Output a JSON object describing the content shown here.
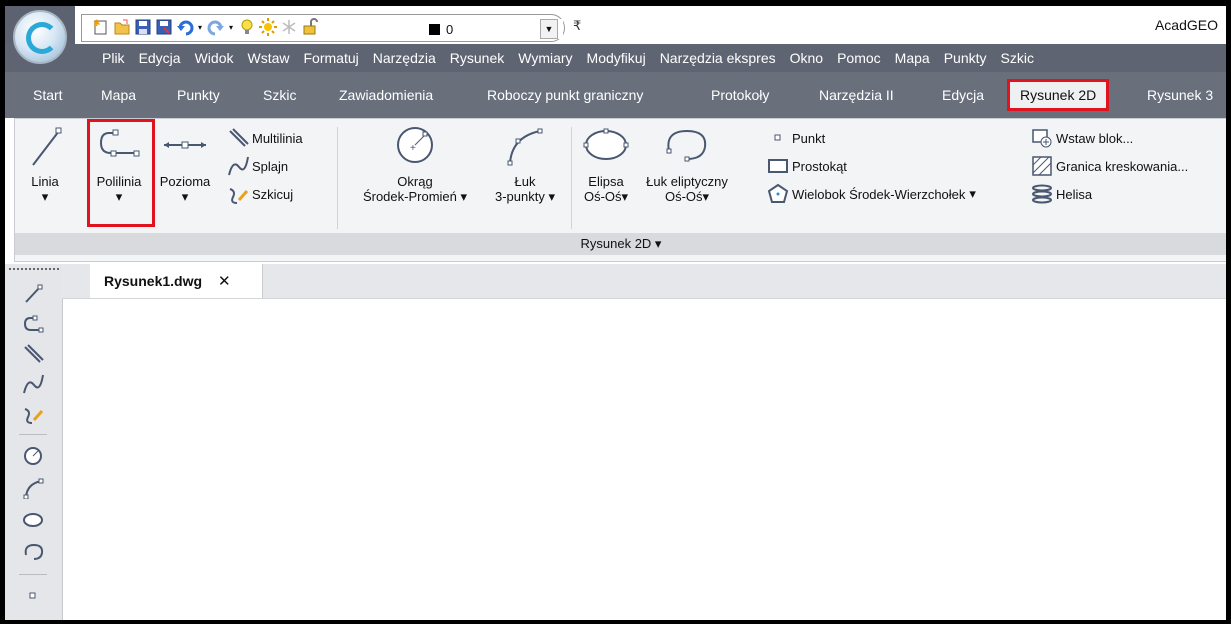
{
  "app": {
    "title": "AcadGEO"
  },
  "quick_access": {
    "layer_value": "0",
    "icons": [
      "new-file-icon",
      "open-folder-icon",
      "save-icon",
      "save-as-icon",
      "undo-icon",
      "redo-icon",
      "lightbulb-icon",
      "sun-icon",
      "layer-freeze-icon",
      "lock-icon",
      "color-swatch-icon"
    ]
  },
  "menu": [
    "Plik",
    "Edycja",
    "Widok",
    "Wstaw",
    "Formatuj",
    "Narzędzia",
    "Rysunek",
    "Wymiary",
    "Modyfikuj",
    "Narzędzia ekspres",
    "Okno",
    "Pomoc",
    "Mapa",
    "Punkty",
    "Szkic"
  ],
  "tabs": [
    "Start",
    "Mapa",
    "Punkty",
    "Szkic",
    "Zawiadomienia",
    "Roboczy punkt graniczny",
    "Protokoły",
    "Narzędzia II",
    "Edycja",
    "Rysunek 2D",
    "Rysunek 3"
  ],
  "active_tab": "Rysunek 2D",
  "ribbon": {
    "panel_title": "Rysunek 2D ▾",
    "large": {
      "linia": "Linia",
      "polilinia": "Polilinia",
      "pozioma": "Pozioma",
      "okrag_1": "Okrąg",
      "okrag_2": "Środek-Promień",
      "luk_1": "Łuk",
      "luk_2": "3-punkty",
      "elipsa_1": "Elipsa",
      "elipsa_2": "Oś-Oś",
      "lukel_1": "Łuk eliptyczny",
      "lukel_2": "Oś-Oś",
      "dropdown": "▾"
    },
    "small": {
      "multilinia": "Multilinia",
      "splajn": "Splajn",
      "szkicuj": "Szkicuj",
      "punkt": "Punkt",
      "prostokat": "Prostokąt",
      "wielobok": "Wielobok Środek-Wierzchołek",
      "wstaw_blok": "Wstaw blok...",
      "granica": "Granica kreskowania...",
      "helisa": "Helisa"
    }
  },
  "document": {
    "tab_name": "Rysunek1.dwg",
    "close": "✕"
  },
  "qat_menu": "₹"
}
